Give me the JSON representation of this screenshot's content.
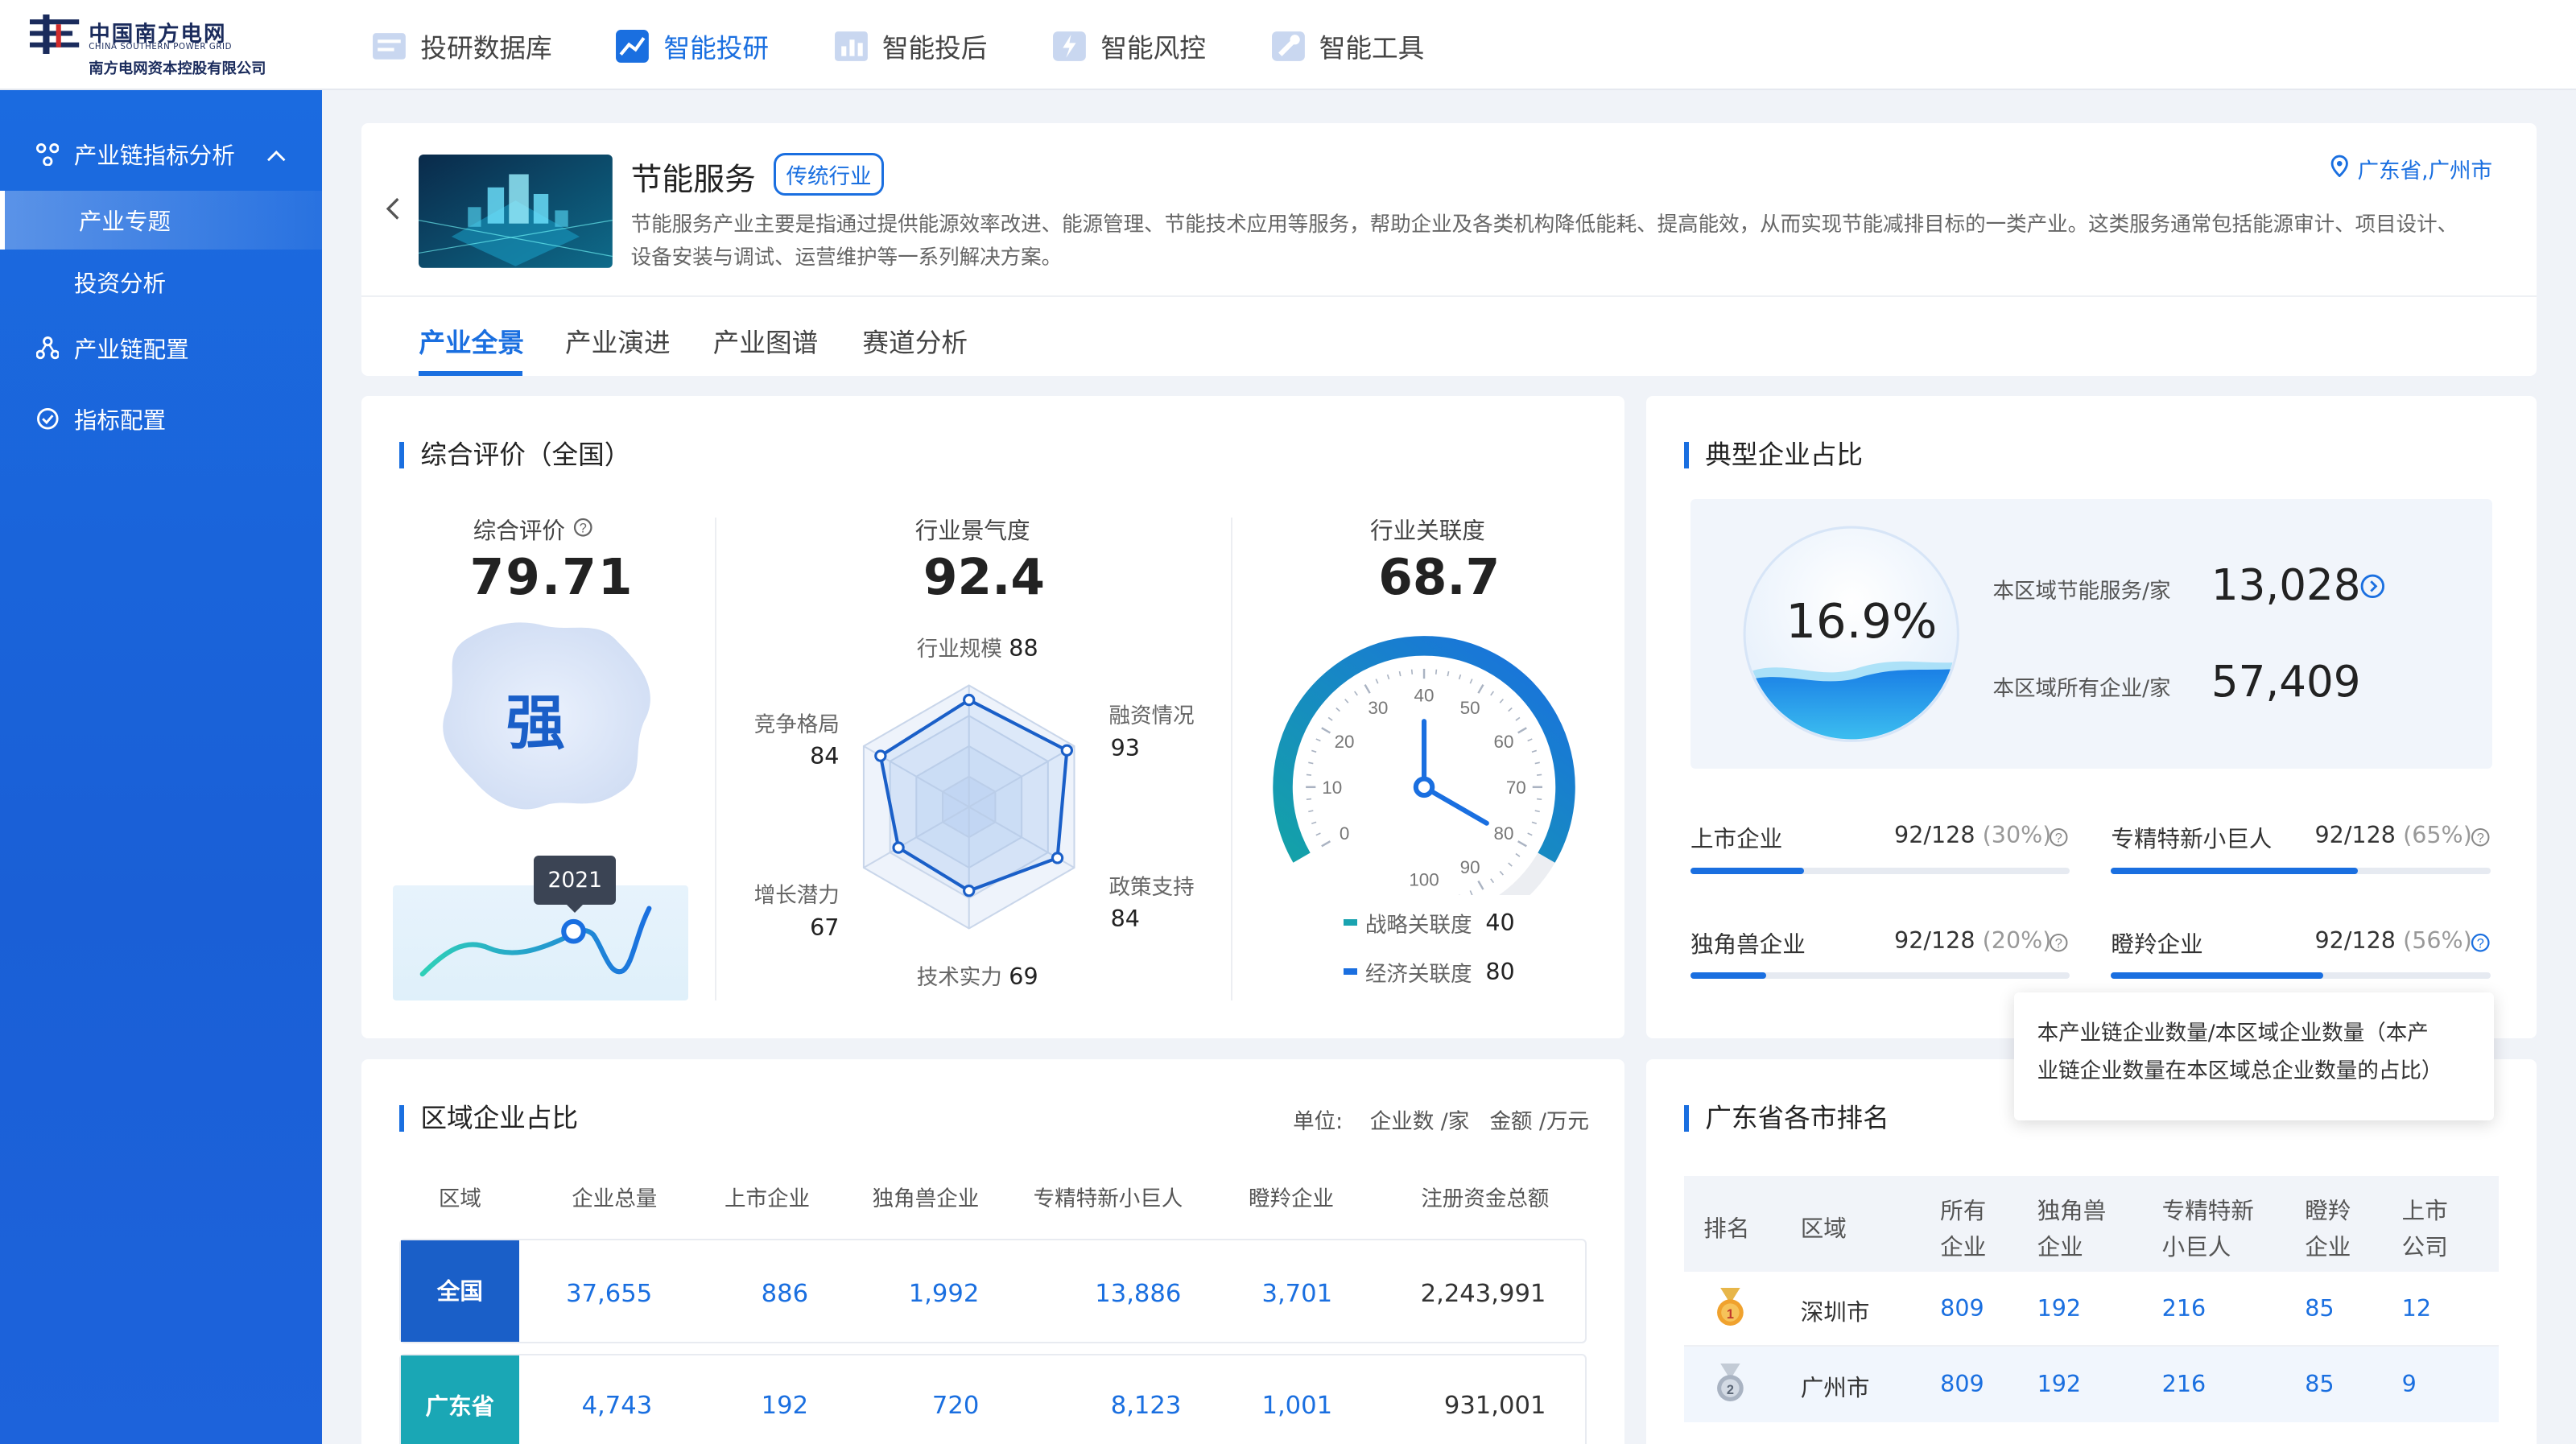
{
  "logo": {
    "cn": "中国南方电网",
    "en": "CHINA SOUTHERN POWER GRID",
    "sub": "南方电网资本控股有限公司"
  },
  "topnav": [
    {
      "label": "投研数据库",
      "icon": "database-icon"
    },
    {
      "label": "智能投研",
      "icon": "trend-chart-icon"
    },
    {
      "label": "智能投后",
      "icon": "bar-chart-icon"
    },
    {
      "label": "智能风控",
      "icon": "shield-lightning-icon"
    },
    {
      "label": "智能工具",
      "icon": "wrench-icon"
    }
  ],
  "sidebar": {
    "group": "产业链指标分析",
    "sub1": "产业专题",
    "sub2": "投资分析",
    "item2": "产业链配置",
    "item3": "指标配置"
  },
  "header": {
    "title": "节能服务",
    "tag": "传统行业",
    "location": "广东省,广州市",
    "desc1": "节能服务产业主要是指通过提供能源效率改进、能源管理、节能技术应用等服务，帮助企业及各类机构降低能耗、提高能效，从而实现节能减排目标的一类产业。这类服务通常包括能源审计、项目设计、",
    "desc2": "设备安装与调试、运营维护等一系列解决方案。"
  },
  "tabs": [
    "产业全景",
    "产业演进",
    "产业图谱",
    "赛道分析"
  ],
  "eval": {
    "title": "综合评价（全国）",
    "score_label": "综合评价",
    "score": "79.71",
    "grade": "强",
    "year": "2021",
    "prosperity_label": "行业景气度",
    "prosperity": "92.4",
    "relevance_label": "行业关联度",
    "relevance": "68.7"
  },
  "chart_data": [
    {
      "type": "radar",
      "axes": [
        "行业规模",
        "融资情况",
        "政策支持",
        "技术实力",
        "增长潜力",
        "竞争格局"
      ],
      "values": [
        88,
        93,
        84,
        69,
        67,
        84
      ],
      "max": 100
    },
    {
      "type": "gauge",
      "ticks": [
        0,
        10,
        20,
        30,
        40,
        50,
        60,
        70,
        80,
        90,
        100
      ],
      "series": [
        {
          "name": "战略关联度",
          "value": 40
        },
        {
          "name": "经济关联度",
          "value": 80
        }
      ]
    }
  ],
  "radar_labels": {
    "a0": "行业规模",
    "v0": "88",
    "a1": "融资情况",
    "v1": "93",
    "a2": "政策支持",
    "v2": "84",
    "a3": "技术实力",
    "v3": "69",
    "a4": "增长潜力",
    "v4": "67",
    "a5": "竞争格局",
    "v5": "84"
  },
  "gauge_legend": {
    "l1": "战略关联度",
    "v1": "40",
    "l2": "经济关联度",
    "v2": "80"
  },
  "typical": {
    "title": "典型企业占比",
    "percent": "16.9%",
    "local_label": "本区域节能服务/家",
    "local_value": "13,028",
    "all_label": "本区域所有企业/家",
    "all_value": "57,409",
    "stats": [
      {
        "label": "上市企业",
        "ratio": "92/128",
        "pct": "(30%)",
        "fill": 0.3
      },
      {
        "label": "专精特新小巨人",
        "ratio": "92/128",
        "pct": "(65%)",
        "fill": 0.65
      },
      {
        "label": "独角兽企业",
        "ratio": "92/128",
        "pct": "(20%)",
        "fill": 0.2
      },
      {
        "label": "瞪羚企业",
        "ratio": "92/128",
        "pct": "(56%)",
        "fill": 0.56
      }
    ],
    "tooltip1": "本产业链企业数量/本区域企业数量（本产",
    "tooltip2": "业链企业数量在本区域总企业数量的占比）"
  },
  "region": {
    "title": "区域企业占比",
    "unit_label": "单位:",
    "unit1": "企业数 /家",
    "unit2": "金额 /万元",
    "headers": [
      "区域",
      "企业总量",
      "上市企业",
      "独角兽企业",
      "专精特新小巨人",
      "瞪羚企业",
      "注册资金总额"
    ],
    "rows": [
      {
        "name": "全国",
        "vals": [
          "37,655",
          "886",
          "1,992",
          "13,886",
          "3,701",
          "2,243,991"
        ]
      },
      {
        "name": "广东省",
        "vals": [
          "4,743",
          "192",
          "720",
          "8,123",
          "1,001",
          "931,001"
        ]
      }
    ]
  },
  "ranking": {
    "title": "广东省各市排名",
    "headers": {
      "rank": "排名",
      "region": "区域",
      "c1a": "所有",
      "c1b": "企业",
      "c2a": "独角兽",
      "c2b": "企业",
      "c3a": "专精特新",
      "c3b": "小巨人",
      "c4a": "瞪羚",
      "c4b": "企业",
      "c5a": "上市",
      "c5b": "公司"
    },
    "rows": [
      {
        "city": "深圳市",
        "vals": [
          "809",
          "192",
          "216",
          "85",
          "12"
        ]
      },
      {
        "city": "广州市",
        "vals": [
          "809",
          "192",
          "216",
          "85",
          "9"
        ]
      }
    ]
  }
}
